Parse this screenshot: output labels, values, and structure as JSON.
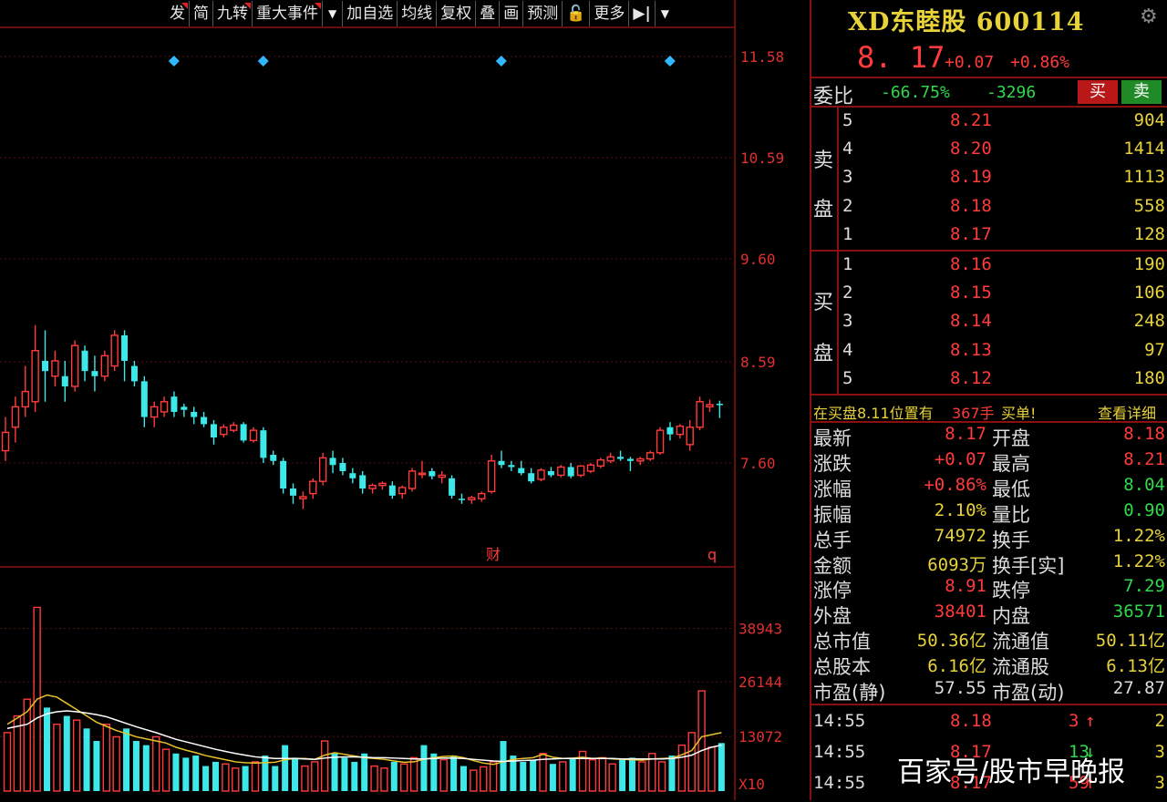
{
  "toolbar": {
    "items": [
      "发",
      "简",
      "九转",
      "重大事件",
      "加自选",
      "均线",
      "复权",
      "叠",
      "画",
      "预测",
      "🔓",
      "更多"
    ],
    "dropdown_glyph": "▼",
    "collapse_glyph": "▶|"
  },
  "chart_data": [
    {
      "type": "candlestick",
      "y_ticks": [
        "11.58",
        "10.59",
        "9.60",
        "8.59",
        "7.60"
      ],
      "y_tick_values": [
        11.58,
        10.59,
        9.6,
        8.59,
        7.6
      ],
      "ylim": [
        6.4,
        12.1
      ],
      "markers": {
        "finance": "财",
        "q": "q"
      },
      "candles": [
        {
          "o": 7.72,
          "h": 8.05,
          "l": 7.62,
          "c": 7.9
        },
        {
          "o": 7.95,
          "h": 8.25,
          "l": 7.8,
          "c": 8.15
        },
        {
          "o": 8.15,
          "h": 8.55,
          "l": 8.05,
          "c": 8.3
        },
        {
          "o": 8.2,
          "h": 8.95,
          "l": 8.1,
          "c": 8.7
        },
        {
          "o": 8.6,
          "h": 8.9,
          "l": 8.2,
          "c": 8.5
        },
        {
          "o": 8.45,
          "h": 8.7,
          "l": 8.35,
          "c": 8.6
        },
        {
          "o": 8.45,
          "h": 8.6,
          "l": 8.2,
          "c": 8.35
        },
        {
          "o": 8.35,
          "h": 8.8,
          "l": 8.3,
          "c": 8.75
        },
        {
          "o": 8.7,
          "h": 8.75,
          "l": 8.4,
          "c": 8.5
        },
        {
          "o": 8.5,
          "h": 8.65,
          "l": 8.3,
          "c": 8.45
        },
        {
          "o": 8.45,
          "h": 8.7,
          "l": 8.4,
          "c": 8.65
        },
        {
          "o": 8.55,
          "h": 8.9,
          "l": 8.5,
          "c": 8.85
        },
        {
          "o": 8.85,
          "h": 8.9,
          "l": 8.4,
          "c": 8.6
        },
        {
          "o": 8.55,
          "h": 8.6,
          "l": 8.35,
          "c": 8.4
        },
        {
          "o": 8.4,
          "h": 8.45,
          "l": 7.95,
          "c": 8.05
        },
        {
          "o": 8.05,
          "h": 8.2,
          "l": 7.95,
          "c": 8.15
        },
        {
          "o": 8.1,
          "h": 8.25,
          "l": 8.05,
          "c": 8.2
        },
        {
          "o": 8.25,
          "h": 8.3,
          "l": 8.05,
          "c": 8.1
        },
        {
          "o": 8.15,
          "h": 8.18,
          "l": 8.05,
          "c": 8.12
        },
        {
          "o": 8.1,
          "h": 8.15,
          "l": 7.98,
          "c": 8.05
        },
        {
          "o": 8.05,
          "h": 8.1,
          "l": 7.95,
          "c": 7.98
        },
        {
          "o": 7.98,
          "h": 8.02,
          "l": 7.78,
          "c": 7.85
        },
        {
          "o": 7.88,
          "h": 7.98,
          "l": 7.85,
          "c": 7.95
        },
        {
          "o": 7.92,
          "h": 8.0,
          "l": 7.9,
          "c": 7.97
        },
        {
          "o": 7.98,
          "h": 8.0,
          "l": 7.8,
          "c": 7.82
        },
        {
          "o": 7.82,
          "h": 7.95,
          "l": 7.8,
          "c": 7.92
        },
        {
          "o": 7.92,
          "h": 7.95,
          "l": 7.6,
          "c": 7.65
        },
        {
          "o": 7.68,
          "h": 7.72,
          "l": 7.58,
          "c": 7.62
        },
        {
          "o": 7.62,
          "h": 7.65,
          "l": 7.3,
          "c": 7.35
        },
        {
          "o": 7.35,
          "h": 7.4,
          "l": 7.2,
          "c": 7.28
        },
        {
          "o": 7.25,
          "h": 7.32,
          "l": 7.15,
          "c": 7.27
        },
        {
          "o": 7.3,
          "h": 7.45,
          "l": 7.25,
          "c": 7.42
        },
        {
          "o": 7.42,
          "h": 7.7,
          "l": 7.38,
          "c": 7.65
        },
        {
          "o": 7.65,
          "h": 7.72,
          "l": 7.5,
          "c": 7.58
        },
        {
          "o": 7.6,
          "h": 7.65,
          "l": 7.48,
          "c": 7.52
        },
        {
          "o": 7.5,
          "h": 7.55,
          "l": 7.4,
          "c": 7.45
        },
        {
          "o": 7.48,
          "h": 7.52,
          "l": 7.3,
          "c": 7.35
        },
        {
          "o": 7.35,
          "h": 7.4,
          "l": 7.3,
          "c": 7.38
        },
        {
          "o": 7.38,
          "h": 7.42,
          "l": 7.34,
          "c": 7.4
        },
        {
          "o": 7.38,
          "h": 7.42,
          "l": 7.25,
          "c": 7.28
        },
        {
          "o": 7.3,
          "h": 7.38,
          "l": 7.25,
          "c": 7.36
        },
        {
          "o": 7.35,
          "h": 7.55,
          "l": 7.32,
          "c": 7.52
        },
        {
          "o": 7.5,
          "h": 7.62,
          "l": 7.45,
          "c": 7.5
        },
        {
          "o": 7.52,
          "h": 7.55,
          "l": 7.44,
          "c": 7.47
        },
        {
          "o": 7.46,
          "h": 7.52,
          "l": 7.4,
          "c": 7.48
        },
        {
          "o": 7.45,
          "h": 7.48,
          "l": 7.25,
          "c": 7.28
        },
        {
          "o": 7.25,
          "h": 7.3,
          "l": 7.2,
          "c": 7.24
        },
        {
          "o": 7.24,
          "h": 7.28,
          "l": 7.2,
          "c": 7.26
        },
        {
          "o": 7.25,
          "h": 7.32,
          "l": 7.22,
          "c": 7.3
        },
        {
          "o": 7.32,
          "h": 7.68,
          "l": 7.3,
          "c": 7.62
        },
        {
          "o": 7.62,
          "h": 7.72,
          "l": 7.55,
          "c": 7.58
        },
        {
          "o": 7.58,
          "h": 7.62,
          "l": 7.52,
          "c": 7.56
        },
        {
          "o": 7.55,
          "h": 7.62,
          "l": 7.48,
          "c": 7.5
        },
        {
          "o": 7.5,
          "h": 7.55,
          "l": 7.4,
          "c": 7.42
        },
        {
          "o": 7.44,
          "h": 7.55,
          "l": 7.42,
          "c": 7.53
        },
        {
          "o": 7.52,
          "h": 7.56,
          "l": 7.46,
          "c": 7.48
        },
        {
          "o": 7.48,
          "h": 7.58,
          "l": 7.46,
          "c": 7.56
        },
        {
          "o": 7.56,
          "h": 7.6,
          "l": 7.45,
          "c": 7.47
        },
        {
          "o": 7.48,
          "h": 7.58,
          "l": 7.46,
          "c": 7.57
        },
        {
          "o": 7.52,
          "h": 7.6,
          "l": 7.5,
          "c": 7.58
        },
        {
          "o": 7.57,
          "h": 7.65,
          "l": 7.55,
          "c": 7.63
        },
        {
          "o": 7.62,
          "h": 7.7,
          "l": 7.6,
          "c": 7.66
        },
        {
          "o": 7.66,
          "h": 7.72,
          "l": 7.62,
          "c": 7.64
        },
        {
          "o": 7.64,
          "h": 7.66,
          "l": 7.52,
          "c": 7.62
        },
        {
          "o": 7.62,
          "h": 7.66,
          "l": 7.58,
          "c": 7.64
        },
        {
          "o": 7.64,
          "h": 7.72,
          "l": 7.62,
          "c": 7.7
        },
        {
          "o": 7.7,
          "h": 7.95,
          "l": 7.68,
          "c": 7.92
        },
        {
          "o": 7.95,
          "h": 8.0,
          "l": 7.82,
          "c": 7.88
        },
        {
          "o": 7.88,
          "h": 7.98,
          "l": 7.84,
          "c": 7.96
        },
        {
          "o": 7.78,
          "h": 8.02,
          "l": 7.72,
          "c": 7.95
        },
        {
          "o": 7.95,
          "h": 8.25,
          "l": 7.92,
          "c": 8.2
        },
        {
          "o": 8.15,
          "h": 8.22,
          "l": 8.1,
          "c": 8.17
        },
        {
          "o": 8.18,
          "h": 8.21,
          "l": 8.04,
          "c": 8.17
        }
      ],
      "diamond_indices": [
        10,
        19,
        43,
        60
      ]
    },
    {
      "type": "bar",
      "y_ticks": [
        "38943",
        "26144",
        "13072",
        "X10"
      ],
      "y_tick_values": [
        38943,
        26144,
        13072
      ],
      "ylim": [
        0,
        46500
      ],
      "volumes": [
        14000,
        18000,
        22000,
        44000,
        20000,
        16000,
        18000,
        17000,
        15000,
        12000,
        16000,
        13000,
        15000,
        12000,
        11000,
        13000,
        10000,
        9000,
        8000,
        8500,
        6000,
        7000,
        6500,
        5500,
        6000,
        7000,
        8500,
        6000,
        11000,
        8000,
        6000,
        7000,
        12000,
        9000,
        8000,
        7000,
        9000,
        6000,
        5500,
        7000,
        6500,
        8000,
        11000,
        9000,
        7500,
        8500,
        6000,
        5000,
        5800,
        7000,
        12000,
        8500,
        7000,
        7500,
        9000,
        6500,
        7000,
        8000,
        9500,
        7500,
        8000,
        6500,
        7500,
        8000,
        7000,
        9000,
        7000,
        8500,
        11000,
        14000,
        24000,
        10500,
        11500
      ],
      "volume_up": [
        true,
        true,
        true,
        true,
        false,
        true,
        false,
        true,
        false,
        false,
        true,
        true,
        false,
        false,
        false,
        true,
        true,
        false,
        false,
        false,
        false,
        false,
        true,
        true,
        false,
        true,
        false,
        false,
        false,
        false,
        true,
        true,
        true,
        false,
        false,
        false,
        false,
        true,
        true,
        false,
        true,
        true,
        false,
        false,
        true,
        false,
        false,
        true,
        true,
        true,
        false,
        false,
        false,
        false,
        true,
        false,
        true,
        false,
        true,
        true,
        true,
        true,
        false,
        false,
        true,
        true,
        true,
        false,
        true,
        true,
        true,
        true,
        false
      ],
      "ma5": [
        16000,
        17500,
        19000,
        22000,
        23000,
        22500,
        21000,
        19500,
        18000,
        16500,
        15500,
        14500,
        13800,
        13000,
        12500,
        12000,
        11500,
        10500,
        9800,
        9200,
        8500,
        8000,
        7500,
        7000,
        6800,
        6700,
        6800,
        6900,
        7500,
        7800,
        7800,
        7600,
        8600,
        9200,
        8800,
        8400,
        8000,
        7800,
        7600,
        7200,
        6900,
        7000,
        7600,
        8000,
        8300,
        8400,
        8000,
        7300,
        6700,
        6400,
        7000,
        7600,
        7800,
        8000,
        8800,
        8100,
        7800,
        7900,
        8100,
        7800,
        7900,
        7700,
        7600,
        7500,
        7400,
        7700,
        7800,
        7900,
        8700,
        9700,
        13000,
        13500,
        14000
      ],
      "ma10": [
        15000,
        15500,
        16000,
        17500,
        18500,
        19000,
        19200,
        19000,
        18700,
        18300,
        17800,
        17000,
        16200,
        15400,
        14700,
        14000,
        13200,
        12400,
        11800,
        11200,
        10600,
        10000,
        9500,
        9000,
        8600,
        8200,
        8000,
        7800,
        7800,
        7800,
        7700,
        7600,
        7900,
        8100,
        8200,
        8200,
        8100,
        8000,
        8000,
        7900,
        7800,
        7700,
        7700,
        7800,
        7900,
        7900,
        7800,
        7600,
        7400,
        7200,
        7100,
        7200,
        7300,
        7400,
        7600,
        7700,
        7800,
        7800,
        7800,
        7800,
        7800,
        7800,
        7700,
        7700,
        7700,
        7700,
        7700,
        7800,
        8100,
        8600,
        9700,
        10500,
        11000
      ]
    }
  ],
  "panel": {
    "title": "XD东睦股 600114",
    "gear_glyph": "⚙",
    "price": "8. 17",
    "change": "+0.07",
    "change_pct": "+0.86%",
    "weibi_label": "委比",
    "weibi_pct": "-66.75%",
    "weibi_diff": "-3296",
    "buy_label": "买",
    "sell_label": "卖",
    "sell_side_label": [
      "卖",
      "盘"
    ],
    "buy_side_label": [
      "买",
      "盘"
    ],
    "asks": [
      {
        "lvl": "5",
        "px": "8.21",
        "vol": "904"
      },
      {
        "lvl": "4",
        "px": "8.20",
        "vol": "1414"
      },
      {
        "lvl": "3",
        "px": "8.19",
        "vol": "1113"
      },
      {
        "lvl": "2",
        "px": "8.18",
        "vol": "558"
      },
      {
        "lvl": "1",
        "px": "8.17",
        "vol": "128"
      }
    ],
    "bids": [
      {
        "lvl": "1",
        "px": "8.16",
        "vol": "190"
      },
      {
        "lvl": "2",
        "px": "8.15",
        "vol": "106"
      },
      {
        "lvl": "3",
        "px": "8.14",
        "vol": "248"
      },
      {
        "lvl": "4",
        "px": "8.13",
        "vol": "97"
      },
      {
        "lvl": "5",
        "px": "8.12",
        "vol": "180"
      }
    ],
    "notice": {
      "a": "在买盘8.11位置有",
      "b": "367手",
      "c": "买单!",
      "detail": "查看详细"
    },
    "quotes": [
      {
        "l1": "最新",
        "v1": "8.17",
        "c1": "#ff3b3b",
        "l2": "开盘",
        "v2": "8.18",
        "c2": "#ff3b3b"
      },
      {
        "l1": "涨跌",
        "v1": "+0.07",
        "c1": "#ff3b3b",
        "l2": "最高",
        "v2": "8.21",
        "c2": "#ff3b3b"
      },
      {
        "l1": "涨幅",
        "v1": "+0.86%",
        "c1": "#ff3b3b",
        "l2": "最低",
        "v2": "8.04",
        "c2": "#2fd94b"
      },
      {
        "l1": "振幅",
        "v1": "2.10%",
        "c1": "#e8d23a",
        "l2": "量比",
        "v2": "0.90",
        "c2": "#2fd94b"
      },
      {
        "l1": "总手",
        "v1": "74972",
        "c1": "#e8d23a",
        "l2": "换手",
        "v2": "1.22%",
        "c2": "#e8d23a"
      },
      {
        "l1": "金额",
        "v1": "6093万",
        "c1": "#e8d23a",
        "l2": "换手[实]",
        "v2": "1.22%",
        "c2": "#e8d23a"
      },
      {
        "l1": "涨停",
        "v1": "8.91",
        "c1": "#ff3b3b",
        "l2": "跌停",
        "v2": "7.29",
        "c2": "#2fd94b"
      },
      {
        "l1": "外盘",
        "v1": "38401",
        "c1": "#ff3b3b",
        "l2": "内盘",
        "v2": "36571",
        "c2": "#2fd94b"
      },
      {
        "l1": "总市值",
        "v1": "50.36亿",
        "c1": "#e8d23a",
        "l2": "流通值",
        "v2": "50.11亿",
        "c2": "#e8d23a"
      },
      {
        "l1": "总股本",
        "v1": "6.16亿",
        "c1": "#e8d23a",
        "l2": "流通股",
        "v2": "6.13亿",
        "c2": "#e8d23a"
      },
      {
        "l1": "市盈(静)",
        "v1": "57.55",
        "c1": "#dddddd",
        "l2": "市盈(动)",
        "v2": "27.87",
        "c2": "#dddddd"
      }
    ],
    "ticks": [
      {
        "time": "14:55",
        "px": "8.18",
        "vol": "3",
        "arrow": "↑",
        "last": "2"
      },
      {
        "time": "14:55",
        "px": "8.17",
        "vol": "13",
        "arrow": "↓",
        "last": "3"
      },
      {
        "time": "14:55",
        "px": "8.17",
        "vol": "59",
        "arrow": "↑",
        "last": "3"
      }
    ],
    "watermark": "百家号/股市早晚报"
  },
  "colors": {
    "up": "#ff3b3b",
    "down": "#3ee8e8",
    "ma5": "#e8c22a",
    "ma10": "#ffffff",
    "grid": "#8a1010",
    "diamond": "#2fb8ff"
  }
}
